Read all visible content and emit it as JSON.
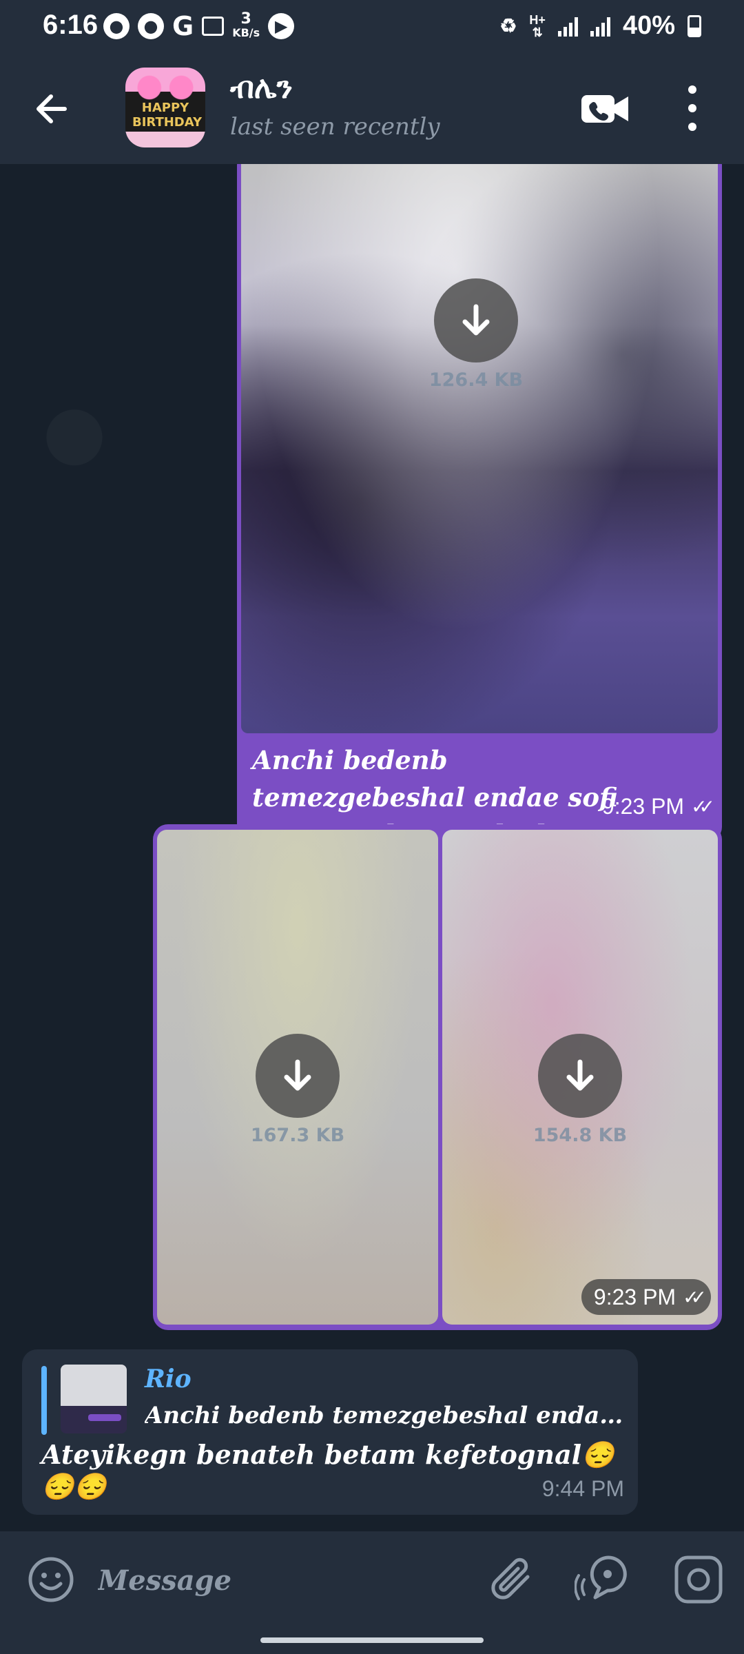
{
  "status_bar": {
    "time": "6:16",
    "net_speed_value": "3",
    "net_speed_unit": "KB/s",
    "network_type": "H+",
    "battery": "40%",
    "left_icons": [
      "location-icon",
      "location-icon",
      "google-icon",
      "image-icon",
      "net-speed",
      "play-icon"
    ],
    "right_icons": [
      "recycle-icon",
      "data-arrows-icon",
      "signal-icon",
      "signal-icon",
      "battery-icon"
    ]
  },
  "header": {
    "title": "ብሌን",
    "subtitle": "last seen recently",
    "avatar_text": "HAPPY BIRTHDAY"
  },
  "messages": {
    "photo_message": {
      "file_size": "126.4 KB",
      "caption": "Anchi bedenb temezgebeshal endae sofi semua yelem eyalech new",
      "time": "9:23 PM"
    },
    "album_message": {
      "items": [
        {
          "file_size": "167.3 KB"
        },
        {
          "file_size": "154.8 KB"
        }
      ],
      "time": "9:23 PM"
    },
    "reply_message": {
      "reply_author": "Rio",
      "reply_text": "Anchi bedenb temezgebeshal endae sofi semu...",
      "text": "Ateyikegn benateh betam kefetognal😔😔😔",
      "time": "9:44 PM"
    }
  },
  "input_bar": {
    "placeholder": "Message"
  },
  "colors": {
    "header_bg": "#242e3c",
    "chat_bg": "#17202b",
    "outgoing_bubble": "#7b4ec4",
    "incoming_bubble": "#252f3d",
    "accent_blue": "#5eb4ff",
    "muted_text": "#8e9aa8"
  }
}
